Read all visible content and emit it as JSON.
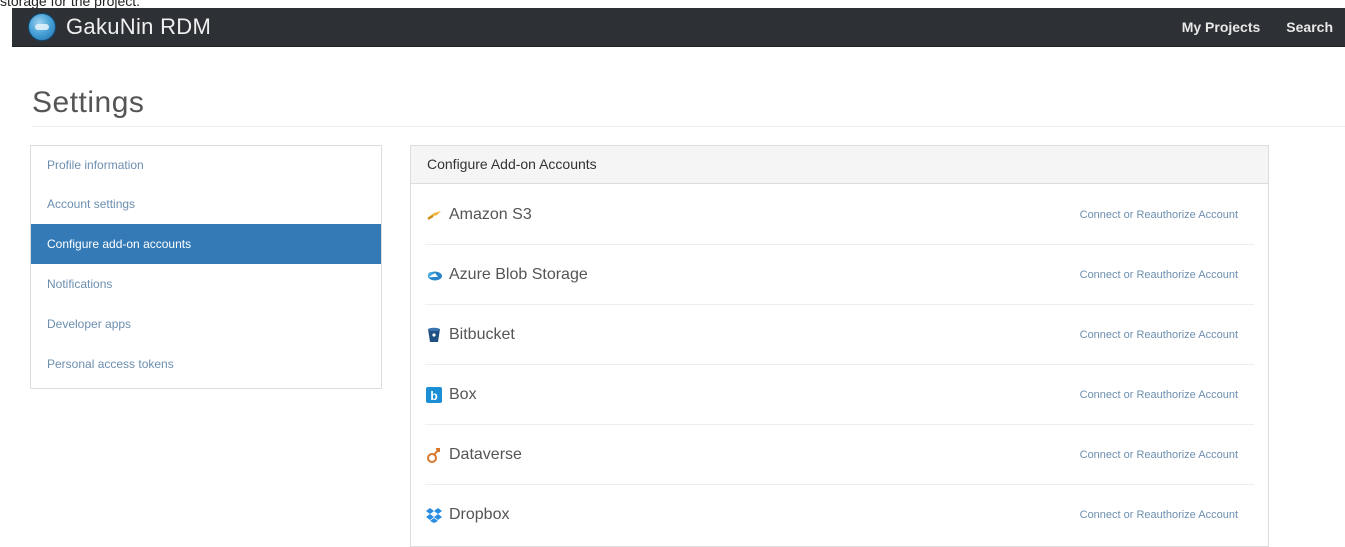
{
  "caption": "storage for the project.",
  "navbar": {
    "brand": "GakuNin RDM",
    "links": [
      "My Projects",
      "Search"
    ]
  },
  "page": {
    "title": "Settings"
  },
  "sidebar": {
    "items": [
      {
        "label": "Profile information",
        "active": false
      },
      {
        "label": "Account settings",
        "active": false
      },
      {
        "label": "Configure add-on accounts",
        "active": true
      },
      {
        "label": "Notifications",
        "active": false
      },
      {
        "label": "Developer apps",
        "active": false
      },
      {
        "label": "Personal access tokens",
        "active": false
      }
    ]
  },
  "panel": {
    "heading": "Configure Add-on Accounts",
    "addons": [
      {
        "name": "Amazon S3",
        "icon": "amazon-s3-icon",
        "action": "Connect or Reauthorize Account"
      },
      {
        "name": "Azure Blob Storage",
        "icon": "azure-icon",
        "action": "Connect or Reauthorize Account"
      },
      {
        "name": "Bitbucket",
        "icon": "bitbucket-icon",
        "action": "Connect or Reauthorize Account"
      },
      {
        "name": "Box",
        "icon": "box-icon",
        "action": "Connect or Reauthorize Account"
      },
      {
        "name": "Dataverse",
        "icon": "dataverse-icon",
        "action": "Connect or Reauthorize Account"
      },
      {
        "name": "Dropbox",
        "icon": "dropbox-icon",
        "action": "Connect or Reauthorize Account"
      }
    ]
  },
  "colors": {
    "navbar": "#2d3034",
    "active": "#337ab7",
    "link": "#6c8fb0"
  }
}
